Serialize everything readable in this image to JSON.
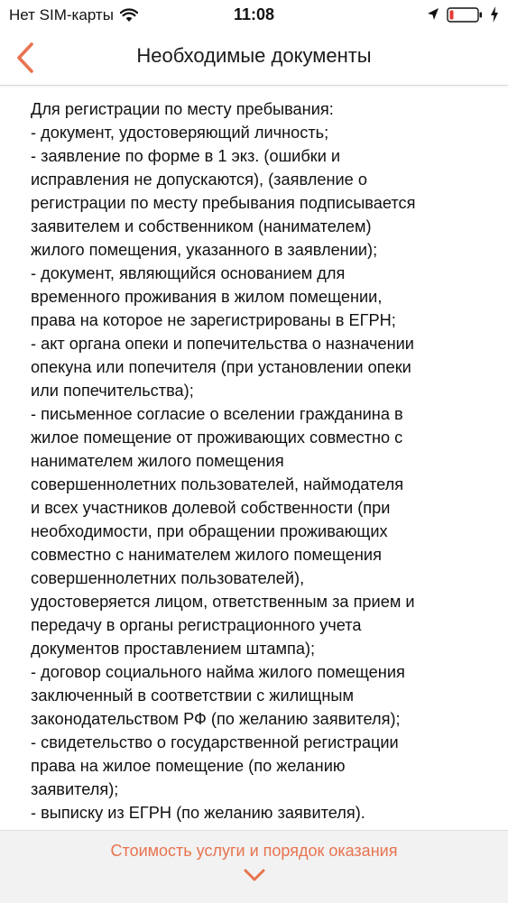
{
  "status_bar": {
    "carrier": "Нет SIM-карты",
    "time": "11:08"
  },
  "header": {
    "title": "Необходимые документы"
  },
  "content": {
    "lines": [
      "Для регистрации по месту пребывания:",
      "- документ, удостоверяющий личность;",
      "- заявление по форме в 1 экз. (ошибки и",
      "исправления не допускаются), (заявление о",
      "регистрации по месту пребывания подписывается",
      "заявителем и собственником (нанимателем)",
      "жилого помещения, указанного в заявлении);",
      "- документ, являющийся основанием для",
      "временного проживания в жилом помещении,",
      "права на которое не зарегистрированы в ЕГРН;",
      "- акт органа опеки и попечительства о назначении",
      "опекуна или попечителя (при установлении опеки",
      "или попечительства);",
      "- письменное согласие о вселении гражданина в",
      "жилое помещение от проживающих совместно с",
      "нанимателем жилого помещения",
      "совершеннолетних пользователей, наймодателя",
      "и всех участников долевой собственности (при",
      "необходимости, при обращении проживающих",
      "совместно с нанимателем жилого помещения",
      "совершеннолетних пользователей),",
      "удостоверяется лицом, ответственным за прием и",
      "передачу в органы регистрационного учета",
      "документов проставлением штампа);",
      "- договор социального найма жилого помещения",
      "заключенный в соответствии с жилищным",
      "законодательством РФ (по желанию заявителя);",
      "-  свидетельство о государственной регистрации",
      "права на жилое помещение (по желанию",
      "заявителя);",
      "- выписку из ЕГРН (по желанию заявителя)."
    ]
  },
  "footer": {
    "link_label": "Стоимость услуги и порядок оказания"
  },
  "colors": {
    "accent": "#e8734f",
    "battery_low": "#e53935"
  },
  "icons": {
    "back": "chevron-left-icon",
    "wifi": "wifi-icon",
    "location": "location-arrow-icon",
    "battery": "battery-icon",
    "charging": "charging-bolt-icon",
    "expand": "chevron-down-icon"
  }
}
